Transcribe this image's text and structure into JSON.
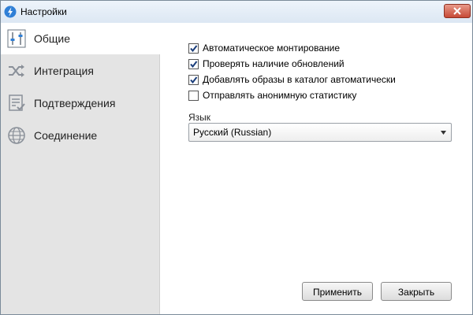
{
  "window": {
    "title": "Настройки"
  },
  "sidebar": {
    "items": [
      {
        "label": "Общие",
        "icon": "sliders-icon",
        "active": true
      },
      {
        "label": "Интеграция",
        "icon": "shuffle-icon",
        "active": false
      },
      {
        "label": "Подтверждения",
        "icon": "checklist-icon",
        "active": false
      },
      {
        "label": "Соединение",
        "icon": "globe-icon",
        "active": false
      }
    ]
  },
  "general": {
    "options": [
      {
        "label": "Автоматическое монтирование",
        "checked": true
      },
      {
        "label": "Проверять наличие обновлений",
        "checked": true
      },
      {
        "label": "Добавлять образы в каталог автоматически",
        "checked": true
      },
      {
        "label": "Отправлять анонимную статистику",
        "checked": false
      }
    ],
    "language_label": "Язык",
    "language_value": "Русский (Russian)"
  },
  "buttons": {
    "apply": "Применить",
    "close": "Закрыть"
  },
  "colors": {
    "accent": "#2f7fd6",
    "close_red": "#c74a36",
    "sidebar_bg": "#e4e4e4"
  }
}
